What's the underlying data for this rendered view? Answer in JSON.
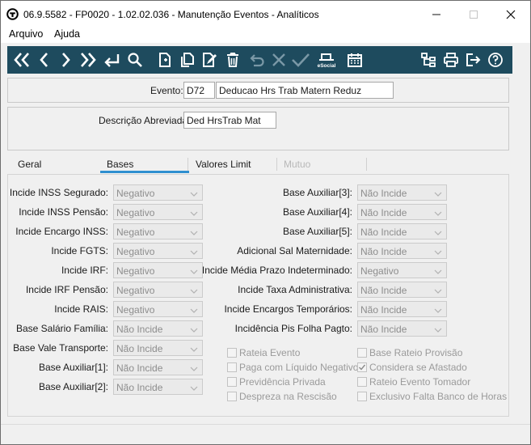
{
  "window": {
    "title": "06.9.5582 - FP0020 - 1.02.02.036 - Manutenção Eventos - Analíticos",
    "app_icon": "totvs-logo-icon"
  },
  "menu": {
    "items": [
      "Arquivo",
      "Ajuda"
    ]
  },
  "toolbar": {
    "background": "#1e4b5e",
    "left_icons": [
      "first-record-icon",
      "previous-record-icon",
      "next-record-icon",
      "last-record-icon",
      "return-icon",
      "search-icon",
      "new-document-icon",
      "copy-document-icon",
      "edit-document-icon",
      "delete-icon",
      "undo-icon",
      "cancel-icon",
      "confirm-icon",
      "esocial-icon",
      "calendar-icon"
    ],
    "esocial_label": "eSocial",
    "right_icons": [
      "structure-icon",
      "print-icon",
      "exit-icon",
      "help-icon"
    ]
  },
  "header": {
    "evento_label": "Evento:",
    "evento_code": "D72",
    "evento_name": "Deducao Hrs Trab Matern Reduz",
    "descricao_label": "Descrição Abreviada:",
    "descricao_value": "Ded HrsTrab Mat"
  },
  "tabs": [
    {
      "label": "Geral",
      "active": false,
      "enabled": true
    },
    {
      "label": "Bases",
      "active": true,
      "enabled": true
    },
    {
      "label": "Valores Limit",
      "active": false,
      "enabled": true
    },
    {
      "label": "Mutuo",
      "active": false,
      "enabled": false
    }
  ],
  "accent_color": "#2f8fd0",
  "bases": {
    "left_fields": [
      {
        "label": "Incide INSS Segurado:",
        "value": "Negativo"
      },
      {
        "label": "Incide INSS Pensão:",
        "value": "Negativo"
      },
      {
        "label": "Incide Encargo INSS:",
        "value": "Negativo"
      },
      {
        "label": "Incide FGTS:",
        "value": "Negativo"
      },
      {
        "label": "Incide IRF:",
        "value": "Negativo"
      },
      {
        "label": "Incide IRF Pensão:",
        "value": "Negativo"
      },
      {
        "label": "Incide RAIS:",
        "value": "Negativo"
      },
      {
        "label": "Base Salário Família:",
        "value": "Não Incide"
      },
      {
        "label": "Base Vale Transporte:",
        "value": "Não Incide"
      },
      {
        "label": "Base Auxiliar[1]:",
        "value": "Não Incide"
      },
      {
        "label": "Base Auxiliar[2]:",
        "value": "Não Incide"
      }
    ],
    "right_fields": [
      {
        "label": "Base Auxiliar[3]:",
        "value": "Não Incide"
      },
      {
        "label": "Base Auxiliar[4]:",
        "value": "Não Incide"
      },
      {
        "label": "Base Auxiliar[5]:",
        "value": "Não Incide"
      },
      {
        "label": "Adicional Sal Maternidade:",
        "value": "Não Incide"
      },
      {
        "label": "Incide Média Prazo Indeterminado:",
        "value": "Negativo"
      },
      {
        "label": "Incide Taxa Administrativa:",
        "value": "Não Incide"
      },
      {
        "label": "Incide Encargos Temporários:",
        "value": "Não Incide"
      },
      {
        "label": "Incidência Pis Folha Pagto:",
        "value": "Não Incide"
      }
    ],
    "checkboxes_left": [
      {
        "label": "Rateia Evento",
        "checked": false
      },
      {
        "label": "Paga com Líquido Negativo",
        "checked": false
      },
      {
        "label": "Previdência Privada",
        "checked": false
      },
      {
        "label": "Despreza na Rescisão",
        "checked": false
      }
    ],
    "checkboxes_right": [
      {
        "label": "Base Rateio Provisão",
        "checked": false
      },
      {
        "label": "Considera se Afastado",
        "checked": true
      },
      {
        "label": "Rateio Evento Tomador",
        "checked": false
      },
      {
        "label": "Exclusivo Falta Banco de Horas",
        "checked": false
      }
    ]
  }
}
